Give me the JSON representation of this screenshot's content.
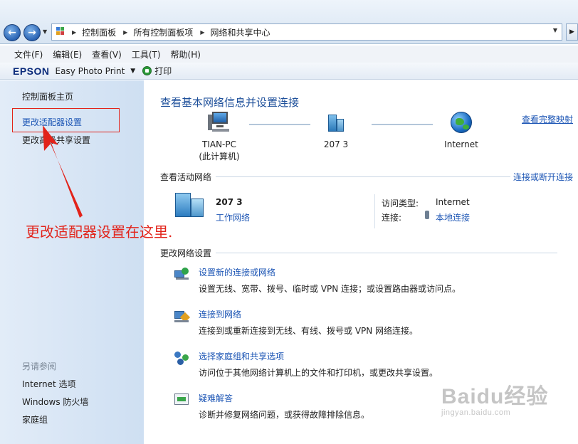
{
  "addressbar": {
    "crumbs": [
      "控制面板",
      "所有控制面板项",
      "网络和共享中心"
    ]
  },
  "menubar": {
    "items": [
      "文件(F)",
      "编辑(E)",
      "查看(V)",
      "工具(T)",
      "帮助(H)"
    ]
  },
  "toolbar": {
    "brand": "EPSON",
    "app": "Easy Photo Print",
    "print": "打印"
  },
  "leftpane": {
    "home": "控制面板主页",
    "adapter": "更改适配器设置",
    "advanced": "更改高级共享设置",
    "see_also": "另请参阅",
    "links": [
      "Internet 选项",
      "Windows 防火墙",
      "家庭组"
    ]
  },
  "annotation": {
    "text": "更改适配器设置在这里."
  },
  "main": {
    "title": "查看基本网络信息并设置连接",
    "view_full_map": "查看完整映射",
    "nodes": {
      "pc_name": "TIAN-PC",
      "pc_sub": "(此计算机)",
      "network": "207  3",
      "internet": "Internet"
    },
    "active_head": "查看活动网络",
    "connect_disconnect": "连接或断开连接",
    "active": {
      "name": "207  3",
      "type": "工作网络",
      "access_label": "访问类型:",
      "access_value": "Internet",
      "conn_label": "连接:",
      "conn_value": "本地连接"
    },
    "change_head": "更改网络设置",
    "tasks": [
      {
        "title": "设置新的连接或网络",
        "desc": "设置无线、宽带、拨号、临时或 VPN 连接；或设置路由器或访问点。"
      },
      {
        "title": "连接到网络",
        "desc": "连接到或重新连接到无线、有线、拨号或 VPN 网络连接。"
      },
      {
        "title": "选择家庭组和共享选项",
        "desc": "访问位于其他网络计算机上的文件和打印机，或更改共享设置。"
      },
      {
        "title": "疑难解答",
        "desc": "诊断并修复网络问题，或获得故障排除信息。"
      }
    ]
  },
  "watermark": {
    "big": "Baidu经验",
    "small": "jingyan.baidu.com"
  },
  "colors": {
    "link": "#1d56b5",
    "title": "#1d4f9a",
    "annotation": "#e2231a"
  }
}
